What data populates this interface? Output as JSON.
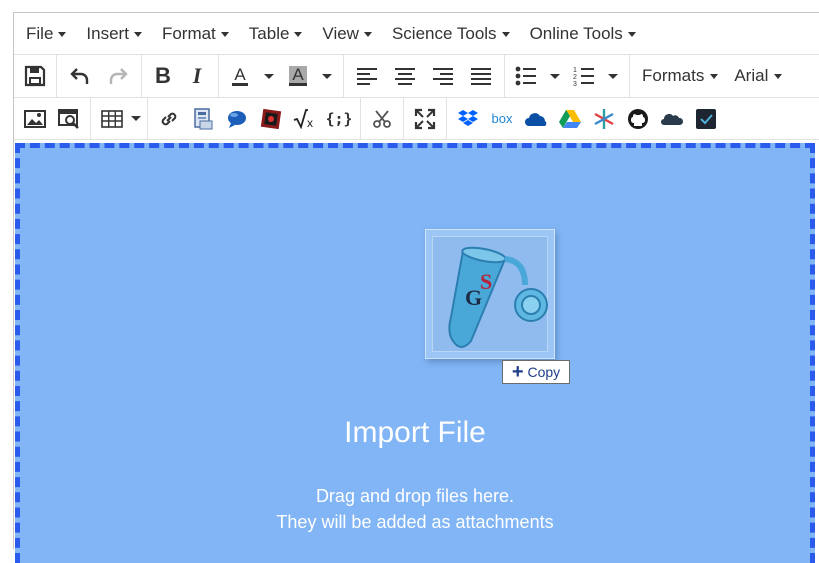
{
  "menubar": {
    "items": [
      {
        "label": "File"
      },
      {
        "label": "Insert"
      },
      {
        "label": "Format"
      },
      {
        "label": "Table"
      },
      {
        "label": "View"
      },
      {
        "label": "Science Tools"
      },
      {
        "label": "Online Tools"
      }
    ]
  },
  "toolbar": {
    "formats_label": "Formats",
    "font_label": "Arial"
  },
  "dropzone": {
    "title": "Import File",
    "line1": "Drag and drop files here.",
    "line2": "They will be added as attachments",
    "copy_label": "Copy",
    "file_icon_letters": "SG"
  },
  "colors": {
    "dropzone_bg": "#82b5f5",
    "dropzone_border": "#2b5bec",
    "text_white": "#ffffff"
  }
}
